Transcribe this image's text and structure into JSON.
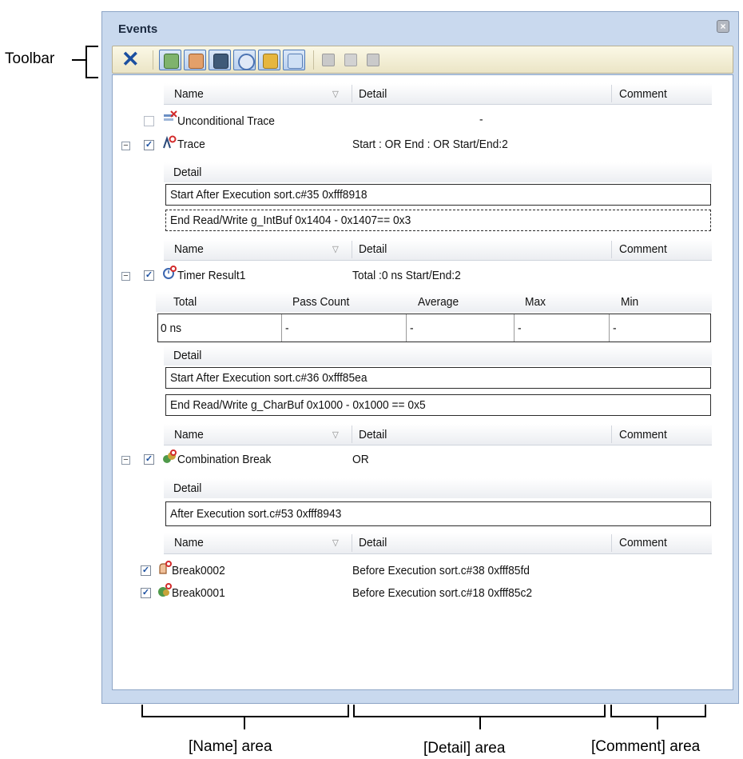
{
  "window": {
    "title": "Events",
    "close_label": "×"
  },
  "toolbar": {
    "delete_label": "✕",
    "buttons": [
      "hardware-break",
      "software-break",
      "trace",
      "timer",
      "combination-break",
      "show-subitems"
    ],
    "disabled": [
      "edit",
      "move",
      "copy"
    ]
  },
  "columns": {
    "name": "Name",
    "detail": "Detail",
    "comment": "Comment",
    "sort": "▽"
  },
  "events": {
    "unconditional_trace": {
      "name": "Unconditional Trace",
      "detail": "-"
    },
    "trace": {
      "name": "Trace",
      "detail": "Start : OR End : OR Start/End:2",
      "sub_header": "Detail",
      "rows": [
        "Start After Execution sort.c#35 0xfff8918",
        "End Read/Write g_IntBuf 0x1404 - 0x1407== 0x3"
      ]
    },
    "timer": {
      "name": "Timer Result1",
      "detail": "Total :0 ns   Start/End:2",
      "result_headers": [
        "Total",
        "Pass Count",
        "Average",
        "Max",
        "Min"
      ],
      "result_values": [
        "0 ns",
        "-",
        "-",
        "-",
        "-"
      ],
      "sub_header": "Detail",
      "rows": [
        "Start After Execution sort.c#36 0xfff85ea",
        "End Read/Write g_CharBuf 0x1000 - 0x1000 == 0x5"
      ]
    },
    "combination": {
      "name": "Combination Break",
      "detail": "OR",
      "sub_header": "Detail",
      "rows": [
        "After Execution sort.c#53 0xfff8943"
      ]
    },
    "break2": {
      "name": "Break0002",
      "detail": "Before Execution sort.c#38 0xfff85fd"
    },
    "break1": {
      "name": "Break0001",
      "detail": "Before Execution sort.c#18 0xfff85c2"
    }
  },
  "annotations": {
    "toolbar": "Toolbar",
    "name_area": "[Name] area",
    "detail_area": "[Detail] area",
    "comment_area": "[Comment] area"
  },
  "colors": {
    "accent": "#1b4fa0",
    "toolbar_bg": "#f3efd6",
    "window_bg": "#c9d9ee"
  }
}
